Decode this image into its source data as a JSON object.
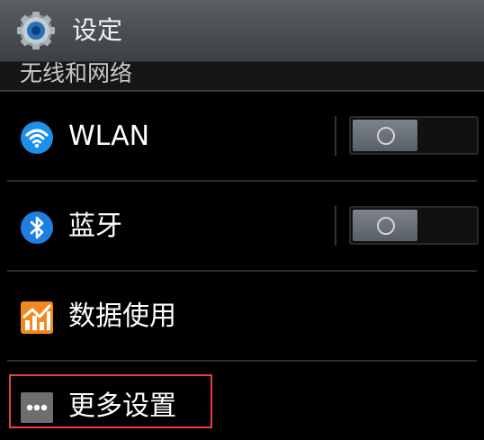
{
  "header": {
    "title": "设定",
    "icon": "settings-gear-icon"
  },
  "section": {
    "title": "无线和网络"
  },
  "rows": [
    {
      "label": "WLAN",
      "icon": "wifi-icon",
      "toggle": "off"
    },
    {
      "label": "蓝牙",
      "icon": "bluetooth-icon",
      "toggle": "off"
    },
    {
      "label": "数据使用",
      "icon": "data-usage-chart-icon"
    },
    {
      "label": "更多设置",
      "icon": "more-dots-icon"
    }
  ],
  "colors": {
    "highlight": "#e0443c",
    "wifi": "#1e90e8",
    "bluetooth": "#1e7fe0",
    "data": "#f08a1e"
  }
}
